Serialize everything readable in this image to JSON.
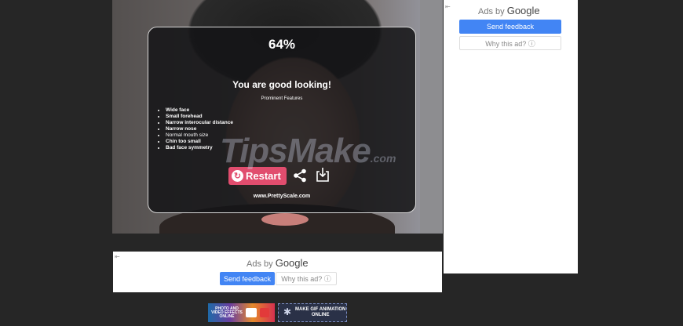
{
  "result": {
    "percent": "64%",
    "verdict": "You are good looking!",
    "features_title": "Prominent Features",
    "features": [
      {
        "text": "Wide face",
        "bold": true
      },
      {
        "text": "Small forehead",
        "bold": true
      },
      {
        "text": "Narrow interocular distance",
        "bold": true
      },
      {
        "text": "Narrow nose",
        "bold": true
      },
      {
        "text": "Normal mouth size",
        "bold": false
      },
      {
        "text": "Chin too small",
        "bold": true
      },
      {
        "text": "Bad face symmetry",
        "bold": true
      }
    ],
    "restart_label": "Restart",
    "site": "www.PrettyScale.com"
  },
  "watermark": {
    "main": "TipsMake",
    "suffix": ".com"
  },
  "ads": {
    "right": {
      "ads_by": "Ads by",
      "google": "Google",
      "feedback": "Send feedback",
      "why": "Why this ad? ⓘ"
    },
    "bottom": {
      "ads_by": "Ads by",
      "google": "Google",
      "feedback": "Send feedback",
      "why": "Why this ad? ⓘ"
    }
  },
  "banners": {
    "photo_effects": "PHOTO AND VIDEO EFFECTS ONLINE",
    "gif": "MAKE GIF ANIMATION ONLINE"
  },
  "colors": {
    "accent": "#e14d6e",
    "google_blue": "#4285f4",
    "background": "#262626"
  }
}
